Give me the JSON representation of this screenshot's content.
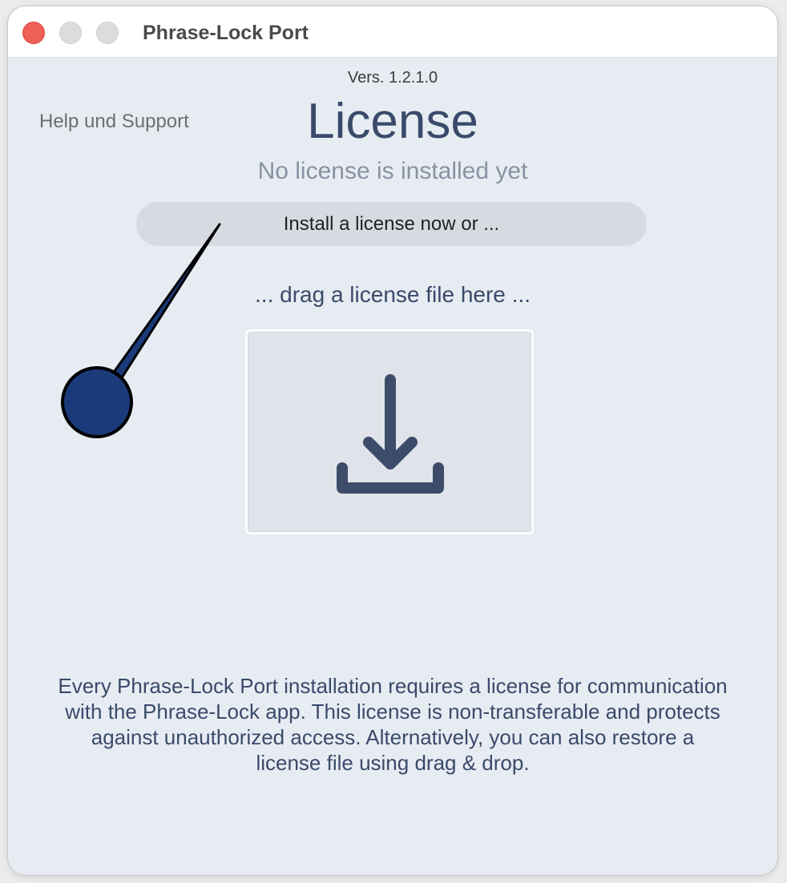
{
  "window": {
    "title": "Phrase-Lock Port"
  },
  "header": {
    "version": "Vers. 1.2.1.0",
    "help_link": "Help und Support",
    "title": "License",
    "status": "No license is installed yet"
  },
  "actions": {
    "install_label": "Install a license now or ...",
    "drag_hint": "... drag a license file here ..."
  },
  "drop_zone": {
    "icon": "download-icon"
  },
  "footer": {
    "description": "Every Phrase-Lock Port installation requires a license for communication with the Phrase-Lock app. This license is non-transferable and protects against unauthorized access. Alternatively, you can also restore a license file using drag & drop."
  },
  "colors": {
    "accent": "#3a4a6a",
    "pointer": "#1a3a7a",
    "close_button": "#ee5f58"
  }
}
